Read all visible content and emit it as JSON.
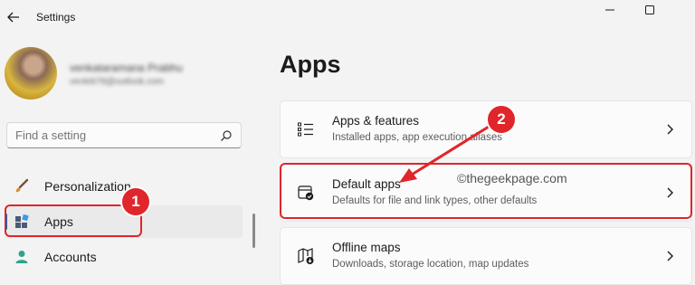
{
  "window": {
    "title": "Settings",
    "controls": {
      "minimize": "—",
      "maximize": "☐"
    }
  },
  "profile": {
    "name": "venkataramana Prabhu",
    "email": "venki678@outlook.com"
  },
  "search": {
    "placeholder": "Find a setting"
  },
  "sidebar": {
    "items": [
      {
        "label": "Personalization",
        "icon": "paintbrush-icon",
        "selected": false
      },
      {
        "label": "Apps",
        "icon": "apps-grid-icon",
        "selected": true
      },
      {
        "label": "Accounts",
        "icon": "person-icon",
        "selected": false
      }
    ]
  },
  "main": {
    "title": "Apps",
    "cards": [
      {
        "title": "Apps & features",
        "subtitle": "Installed apps, app execution aliases",
        "icon": "list-icon"
      },
      {
        "title": "Default apps",
        "subtitle": "Defaults for file and link types, other defaults",
        "icon": "default-apps-icon"
      },
      {
        "title": "Offline maps",
        "subtitle": "Downloads, storage location, map updates",
        "icon": "map-download-icon"
      }
    ]
  },
  "annotations": {
    "badge_1": "1",
    "badge_2": "2",
    "watermark": "©thegeekpage.com",
    "color": "#e0252b"
  },
  "colors": {
    "accent": "#0067c0",
    "background": "#f3f3f3",
    "card": "#fbfbfb"
  }
}
